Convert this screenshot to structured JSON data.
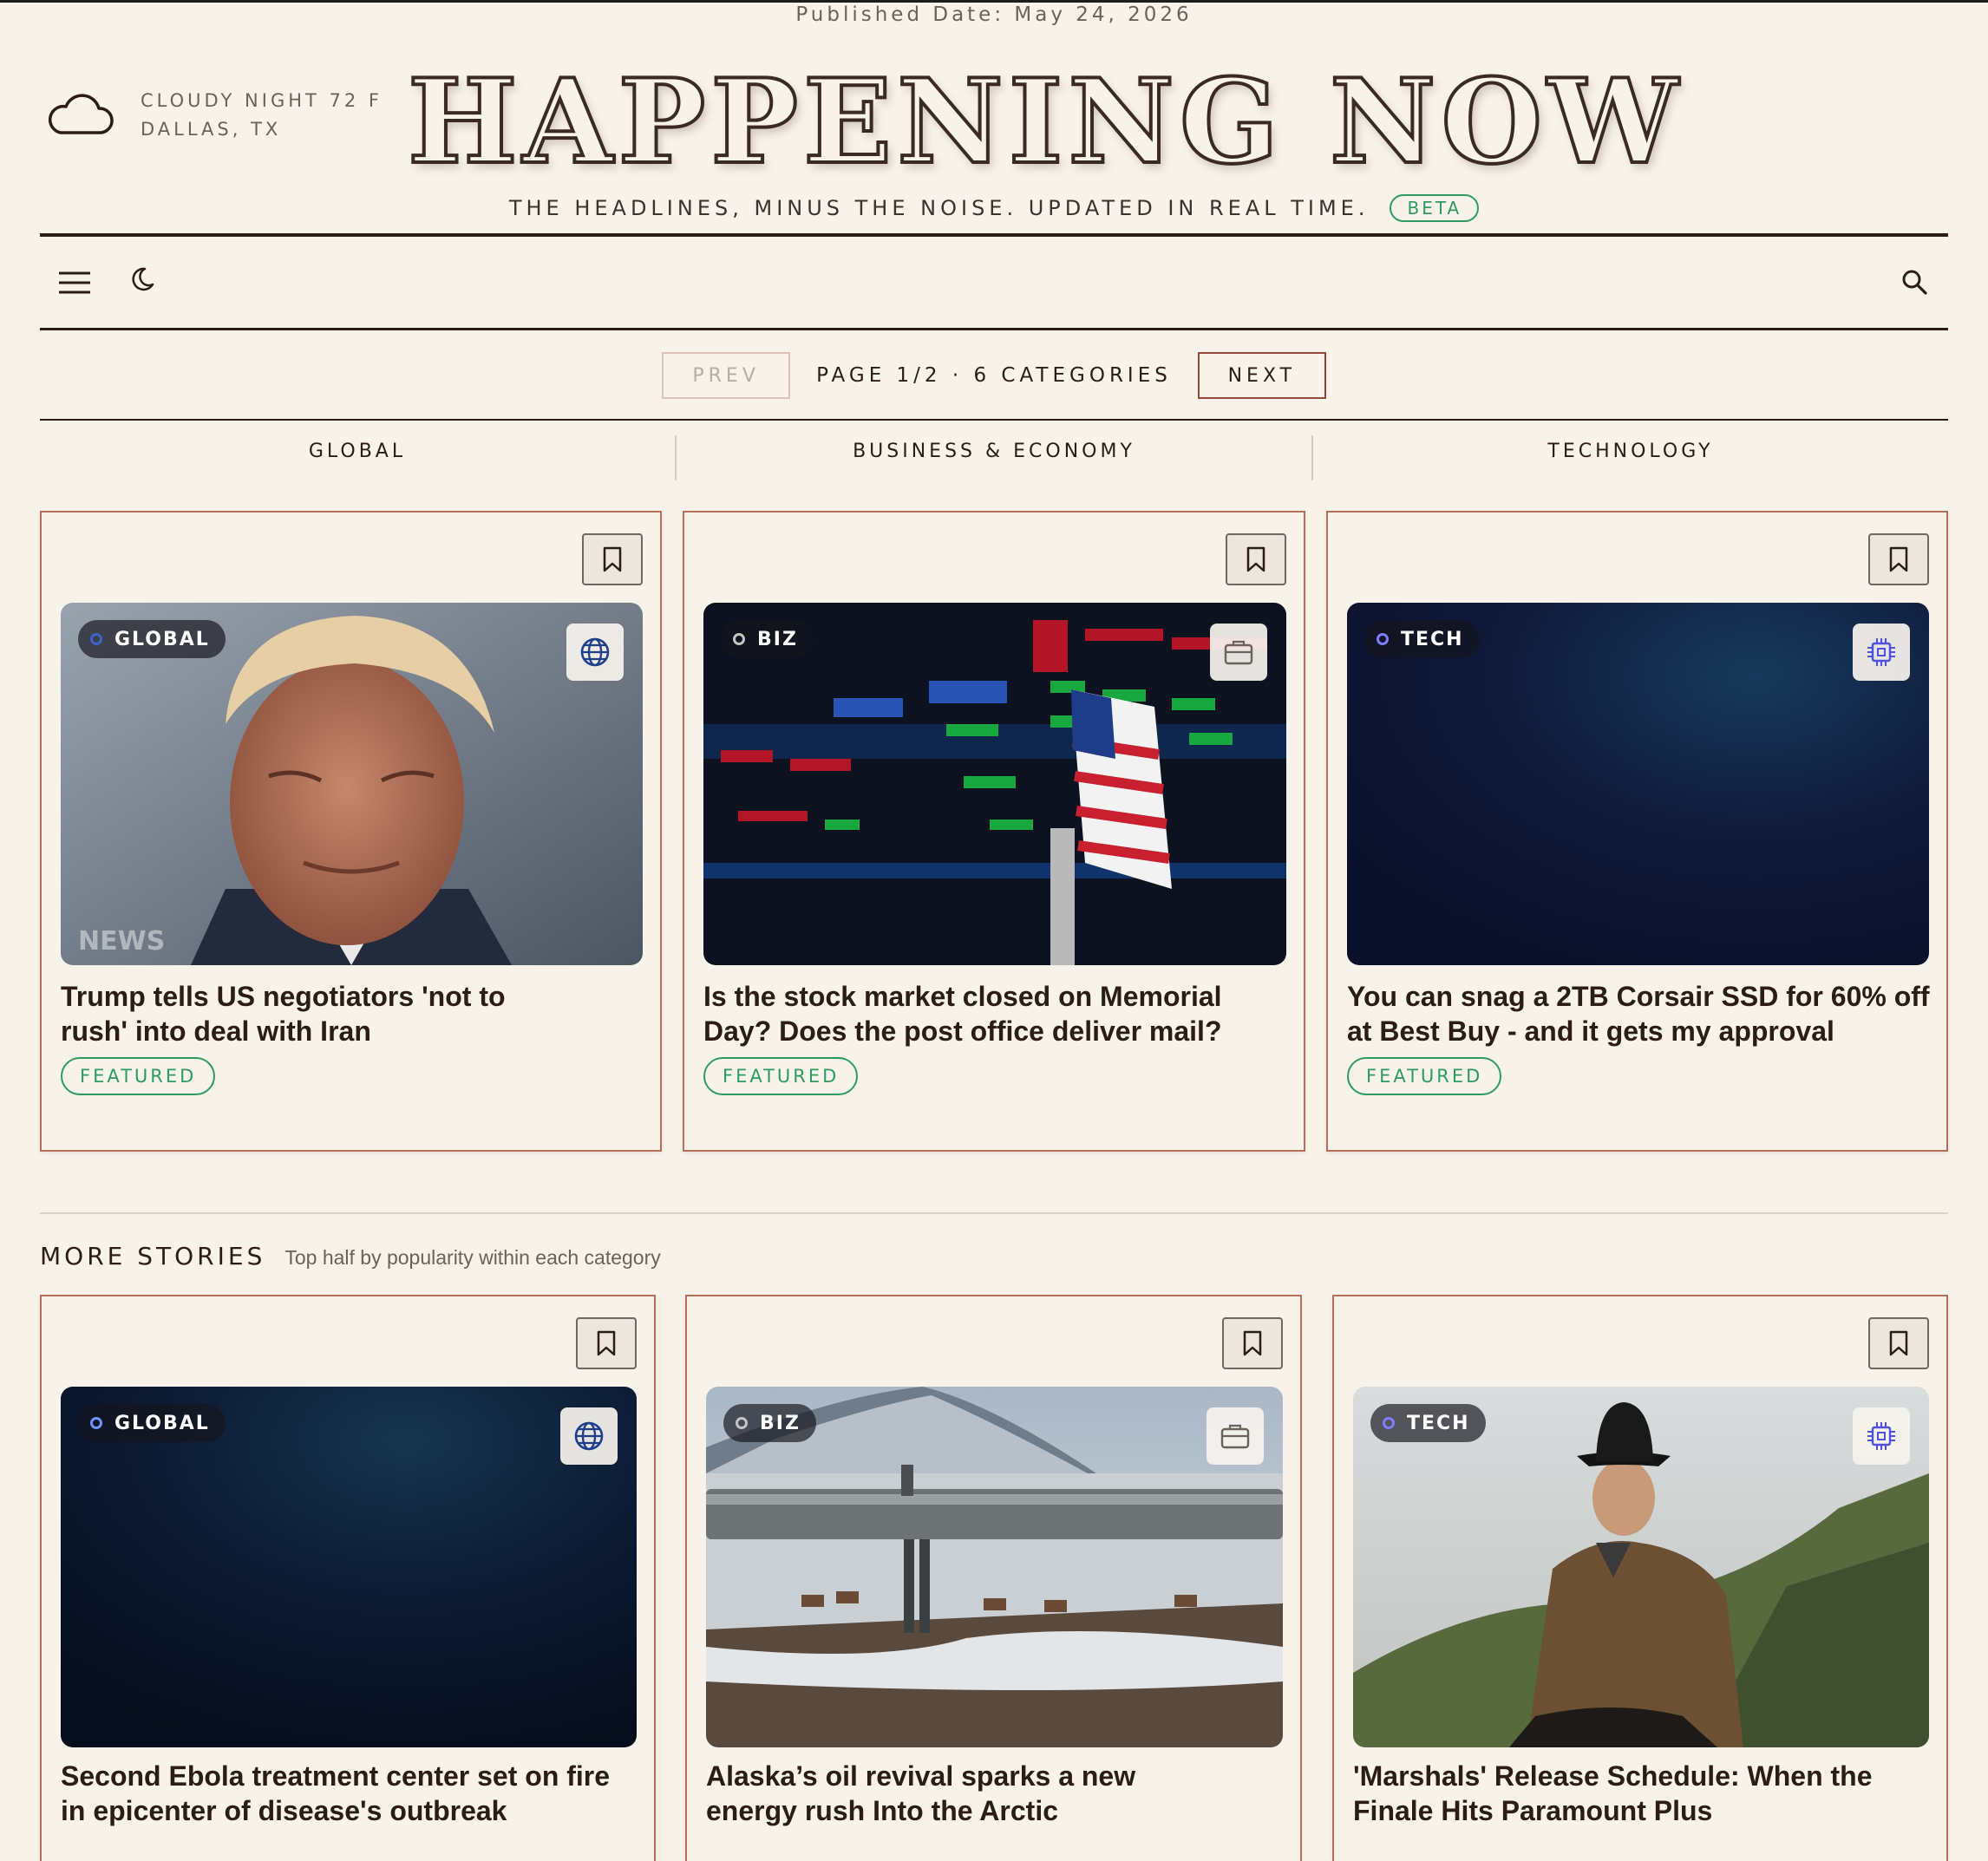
{
  "published": "Published Date: May 24, 2026",
  "weather": {
    "line1": "CLOUDY NIGHT 72 F",
    "line2": "DALLAS, TX",
    "icon": "cloud-icon"
  },
  "masthead": {
    "title": "HAPPENING NOW",
    "tagline": "THE HEADLINES, MINUS THE NOISE. UPDATED IN REAL TIME.",
    "badge": "BETA"
  },
  "toolbar": {
    "menu_icon": "menu-icon",
    "theme_icon": "moon-icon",
    "search_icon": "search-icon"
  },
  "pager": {
    "prev": "PREV",
    "info": "PAGE 1/2 · 6 CATEGORIES",
    "next": "NEXT"
  },
  "categories": [
    "GLOBAL",
    "BUSINESS & ECONOMY",
    "TECHNOLOGY"
  ],
  "featured": [
    {
      "tag": "GLOBAL",
      "title": "Trump tells US negotiators 'not to rush' into deal with Iran",
      "badge": "FEATURED",
      "icon": "globe-icon",
      "watermark": "NEWS"
    },
    {
      "tag": "BIZ",
      "title": "Is the stock market closed on Memorial Day? Does the post office deliver mail?",
      "badge": "FEATURED",
      "icon": "briefcase-icon"
    },
    {
      "tag": "TECH",
      "title": "You can snag a 2TB Corsair SSD for 60% off at Best Buy - and it gets my approval",
      "badge": "FEATURED",
      "icon": "chip-icon"
    }
  ],
  "more": {
    "heading": "MORE STORIES",
    "subheading": "Top half by popularity within each category",
    "stories": [
      {
        "tag": "GLOBAL",
        "title": "Second Ebola treatment center set on fire in epicenter of disease's outbreak",
        "icon": "globe-icon"
      },
      {
        "tag": "BIZ",
        "title": "Alaska’s oil revival sparks a new energy rush Into the Arctic",
        "icon": "briefcase-icon"
      },
      {
        "tag": "TECH",
        "title": "'Marshals' Release Schedule: When the Finale Hits Paramount Plus",
        "icon": "chip-icon"
      }
    ]
  },
  "colors": {
    "background": "#f7f2ea",
    "card_border": "#b5705c",
    "featured_green": "#2e9b61",
    "global_dot": "#3f63c8",
    "biz_dot": "#c4c4c4",
    "tech_dot": "#7d7dff"
  }
}
